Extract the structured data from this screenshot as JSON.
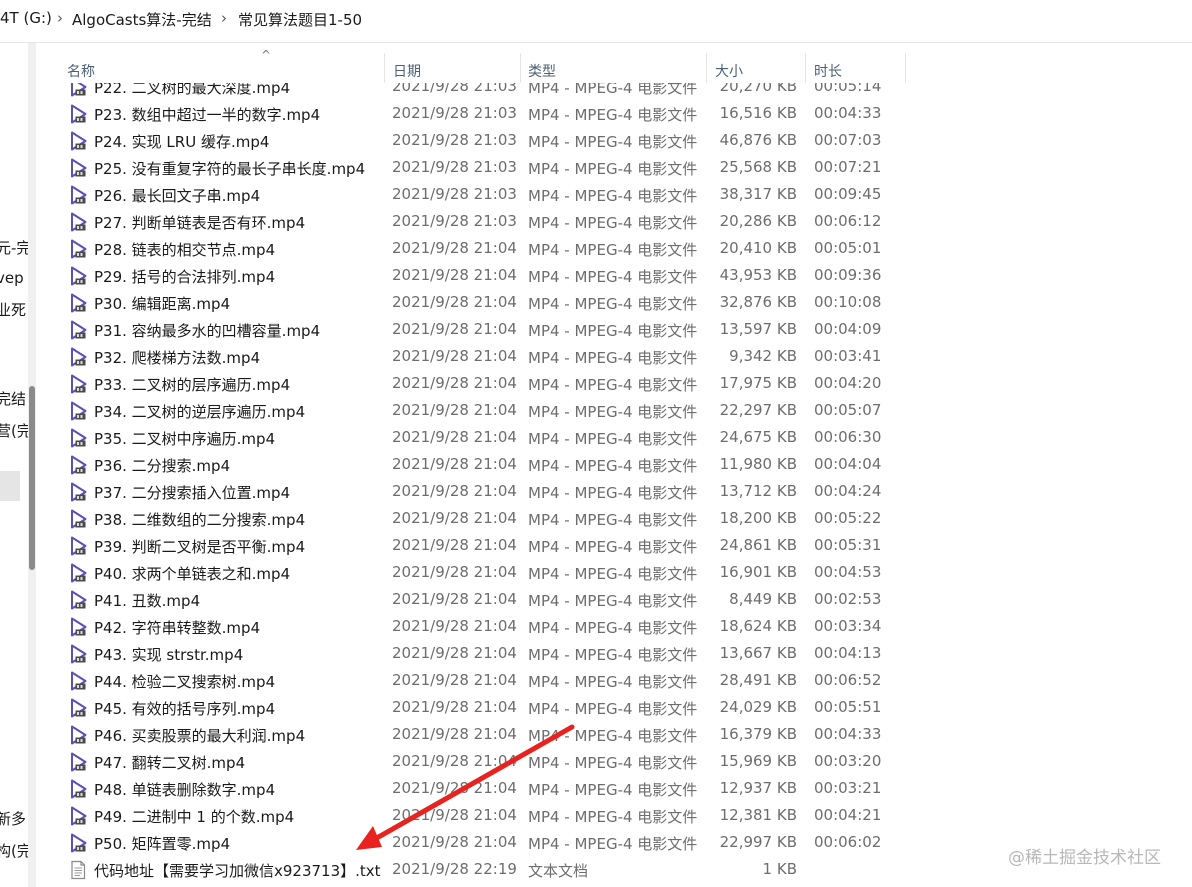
{
  "breadcrumb": {
    "items": [
      "4T (G:)",
      "AlgoCasts算法-完结",
      "常见算法题目1-50"
    ],
    "separator": "›"
  },
  "nav_fragments": [
    "元-完",
    "vep",
    "业死",
    "完结",
    "营(完",
    "新多",
    "构(完"
  ],
  "columns": {
    "name": "名称",
    "date": "日期",
    "type": "类型",
    "size": "大小",
    "duration": "时长"
  },
  "sort_indicator": "^",
  "files": [
    {
      "name": "P22. 二叉树的最大深度.mp4",
      "date": "2021/9/28 21:03",
      "type": "MP4 - MPEG-4 电影文件",
      "size": "20,270 KB",
      "duration": "00:05:14",
      "icon": "video-file-icon"
    },
    {
      "name": "P23. 数组中超过一半的数字.mp4",
      "date": "2021/9/28 21:03",
      "type": "MP4 - MPEG-4 电影文件",
      "size": "16,516 KB",
      "duration": "00:04:33",
      "icon": "video-file-icon"
    },
    {
      "name": "P24. 实现 LRU 缓存.mp4",
      "date": "2021/9/28 21:03",
      "type": "MP4 - MPEG-4 电影文件",
      "size": "46,876 KB",
      "duration": "00:07:03",
      "icon": "video-file-icon"
    },
    {
      "name": "P25. 没有重复字符的最长子串长度.mp4",
      "date": "2021/9/28 21:03",
      "type": "MP4 - MPEG-4 电影文件",
      "size": "25,568 KB",
      "duration": "00:07:21",
      "icon": "video-file-icon"
    },
    {
      "name": "P26. 最长回文子串.mp4",
      "date": "2021/9/28 21:03",
      "type": "MP4 - MPEG-4 电影文件",
      "size": "38,317 KB",
      "duration": "00:09:45",
      "icon": "video-file-icon"
    },
    {
      "name": "P27. 判断单链表是否有环.mp4",
      "date": "2021/9/28 21:03",
      "type": "MP4 - MPEG-4 电影文件",
      "size": "20,286 KB",
      "duration": "00:06:12",
      "icon": "video-file-icon"
    },
    {
      "name": "P28. 链表的相交节点.mp4",
      "date": "2021/9/28 21:04",
      "type": "MP4 - MPEG-4 电影文件",
      "size": "20,410 KB",
      "duration": "00:05:01",
      "icon": "video-file-icon"
    },
    {
      "name": "P29. 括号的合法排列.mp4",
      "date": "2021/9/28 21:04",
      "type": "MP4 - MPEG-4 电影文件",
      "size": "43,953 KB",
      "duration": "00:09:36",
      "icon": "video-file-icon"
    },
    {
      "name": "P30. 编辑距离.mp4",
      "date": "2021/9/28 21:04",
      "type": "MP4 - MPEG-4 电影文件",
      "size": "32,876 KB",
      "duration": "00:10:08",
      "icon": "video-file-icon"
    },
    {
      "name": "P31. 容纳最多水的凹槽容量.mp4",
      "date": "2021/9/28 21:04",
      "type": "MP4 - MPEG-4 电影文件",
      "size": "13,597 KB",
      "duration": "00:04:09",
      "icon": "video-file-icon"
    },
    {
      "name": "P32. 爬楼梯方法数.mp4",
      "date": "2021/9/28 21:04",
      "type": "MP4 - MPEG-4 电影文件",
      "size": "9,342 KB",
      "duration": "00:03:41",
      "icon": "video-file-icon"
    },
    {
      "name": "P33. 二叉树的层序遍历.mp4",
      "date": "2021/9/28 21:04",
      "type": "MP4 - MPEG-4 电影文件",
      "size": "17,975 KB",
      "duration": "00:04:20",
      "icon": "video-file-icon"
    },
    {
      "name": "P34. 二叉树的逆层序遍历.mp4",
      "date": "2021/9/28 21:04",
      "type": "MP4 - MPEG-4 电影文件",
      "size": "22,297 KB",
      "duration": "00:05:07",
      "icon": "video-file-icon"
    },
    {
      "name": "P35. 二叉树中序遍历.mp4",
      "date": "2021/9/28 21:04",
      "type": "MP4 - MPEG-4 电影文件",
      "size": "24,675 KB",
      "duration": "00:06:30",
      "icon": "video-file-icon"
    },
    {
      "name": "P36. 二分搜索.mp4",
      "date": "2021/9/28 21:04",
      "type": "MP4 - MPEG-4 电影文件",
      "size": "11,980 KB",
      "duration": "00:04:04",
      "icon": "video-file-icon"
    },
    {
      "name": "P37. 二分搜索插入位置.mp4",
      "date": "2021/9/28 21:04",
      "type": "MP4 - MPEG-4 电影文件",
      "size": "13,712 KB",
      "duration": "00:04:24",
      "icon": "video-file-icon"
    },
    {
      "name": "P38. 二维数组的二分搜索.mp4",
      "date": "2021/9/28 21:04",
      "type": "MP4 - MPEG-4 电影文件",
      "size": "18,200 KB",
      "duration": "00:05:22",
      "icon": "video-file-icon"
    },
    {
      "name": "P39. 判断二叉树是否平衡.mp4",
      "date": "2021/9/28 21:04",
      "type": "MP4 - MPEG-4 电影文件",
      "size": "24,861 KB",
      "duration": "00:05:31",
      "icon": "video-file-icon"
    },
    {
      "name": "P40. 求两个单链表之和.mp4",
      "date": "2021/9/28 21:04",
      "type": "MP4 - MPEG-4 电影文件",
      "size": "16,901 KB",
      "duration": "00:04:53",
      "icon": "video-file-icon"
    },
    {
      "name": "P41. 丑数.mp4",
      "date": "2021/9/28 21:04",
      "type": "MP4 - MPEG-4 电影文件",
      "size": "8,449 KB",
      "duration": "00:02:53",
      "icon": "video-file-icon"
    },
    {
      "name": "P42. 字符串转整数.mp4",
      "date": "2021/9/28 21:04",
      "type": "MP4 - MPEG-4 电影文件",
      "size": "18,624 KB",
      "duration": "00:03:34",
      "icon": "video-file-icon"
    },
    {
      "name": "P43. 实现 strstr.mp4",
      "date": "2021/9/28 21:04",
      "type": "MP4 - MPEG-4 电影文件",
      "size": "13,667 KB",
      "duration": "00:04:13",
      "icon": "video-file-icon"
    },
    {
      "name": "P44. 检验二叉搜索树.mp4",
      "date": "2021/9/28 21:04",
      "type": "MP4 - MPEG-4 电影文件",
      "size": "28,491 KB",
      "duration": "00:06:52",
      "icon": "video-file-icon"
    },
    {
      "name": "P45. 有效的括号序列.mp4",
      "date": "2021/9/28 21:04",
      "type": "MP4 - MPEG-4 电影文件",
      "size": "24,029 KB",
      "duration": "00:05:51",
      "icon": "video-file-icon"
    },
    {
      "name": "P46. 买卖股票的最大利润.mp4",
      "date": "2021/9/28 21:04",
      "type": "MP4 - MPEG-4 电影文件",
      "size": "16,379 KB",
      "duration": "00:04:33",
      "icon": "video-file-icon"
    },
    {
      "name": "P47. 翻转二叉树.mp4",
      "date": "2021/9/28 21:04",
      "type": "MP4 - MPEG-4 电影文件",
      "size": "15,969 KB",
      "duration": "00:03:20",
      "icon": "video-file-icon"
    },
    {
      "name": "P48. 单链表删除数字.mp4",
      "date": "2021/9/28 21:04",
      "type": "MP4 - MPEG-4 电影文件",
      "size": "12,937 KB",
      "duration": "00:03:21",
      "icon": "video-file-icon"
    },
    {
      "name": "P49. 二进制中 1 的个数.mp4",
      "date": "2021/9/28 21:04",
      "type": "MP4 - MPEG-4 电影文件",
      "size": "12,381 KB",
      "duration": "00:04:21",
      "icon": "video-file-icon"
    },
    {
      "name": "P50. 矩阵置零.mp4",
      "date": "2021/9/28 21:04",
      "type": "MP4 - MPEG-4 电影文件",
      "size": "22,997 KB",
      "duration": "00:06:02",
      "icon": "video-file-icon"
    },
    {
      "name": "代码地址【需要学习加微信x923713】.txt",
      "date": "2021/9/28 22:19",
      "type": "文本文档",
      "size": "1 KB",
      "duration": "",
      "icon": "text-file-icon"
    }
  ],
  "watermark": "@稀土掘金技术社区",
  "colors": {
    "video_icon": "#5b4fb8",
    "annotation_arrow": "#e8221e",
    "header_text": "#4c607a",
    "secondary_text": "#6d6d6d"
  }
}
